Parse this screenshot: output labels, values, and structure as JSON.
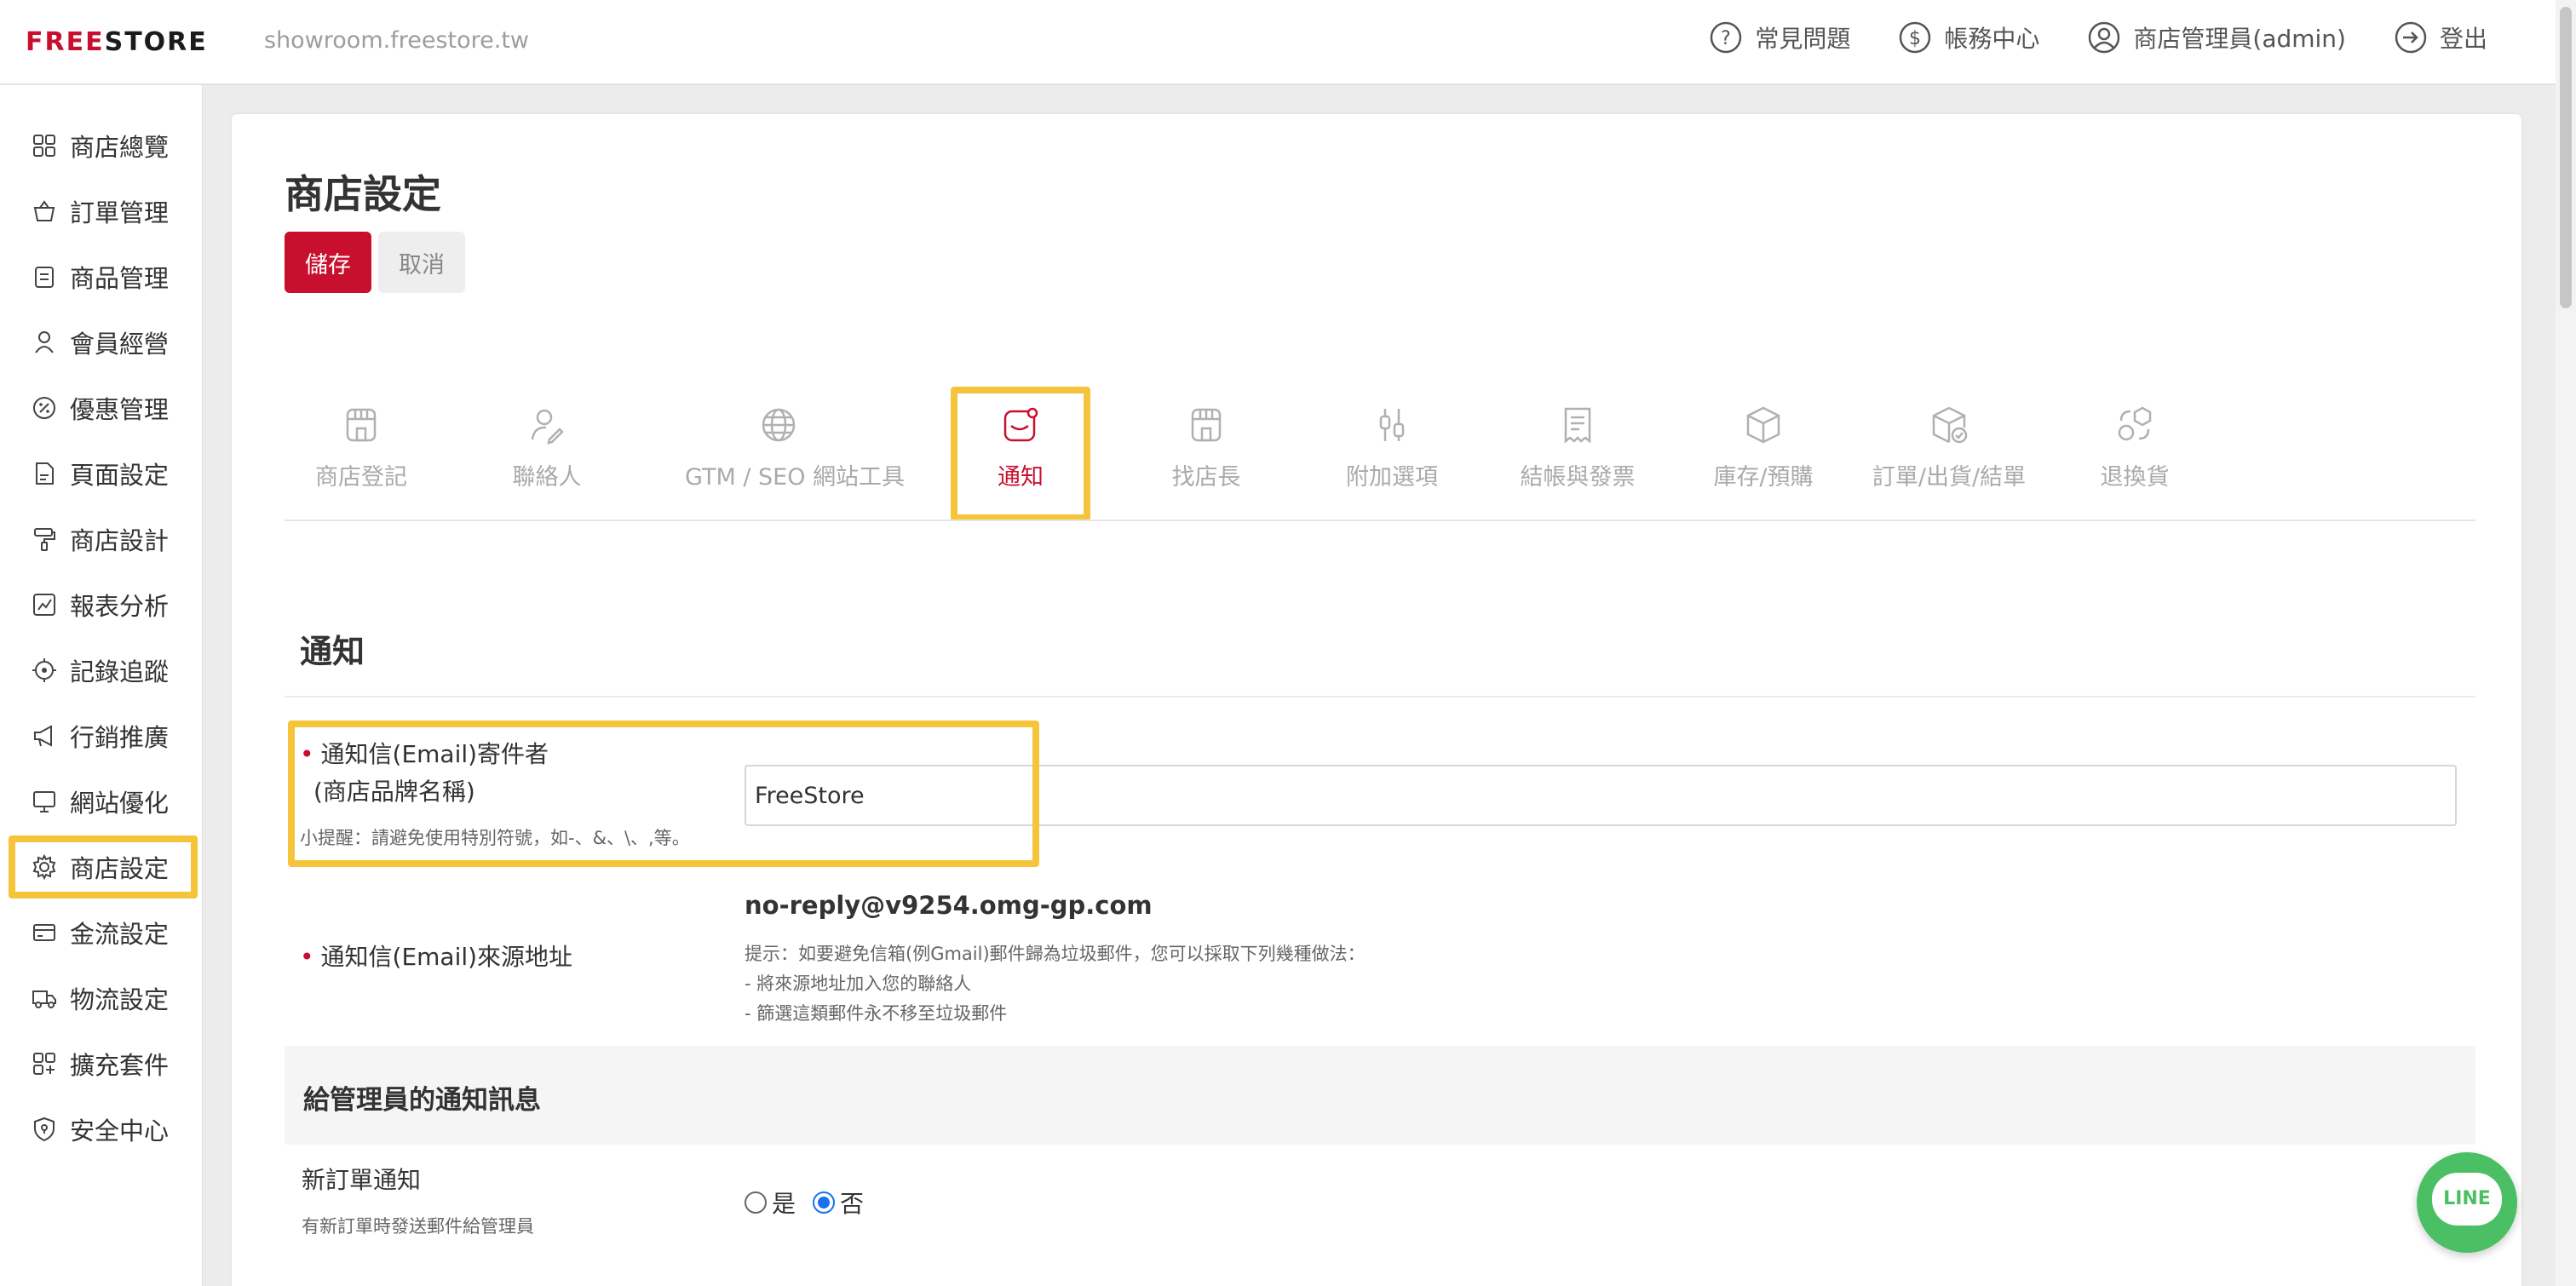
{
  "topbar": {
    "logo_prefix": "FREE",
    "logo_suffix": "STORE",
    "store_url": "showroom.freestore.tw",
    "links": [
      "常見問題",
      "帳務中心",
      "商店管理員(admin)",
      "登出"
    ]
  },
  "sidebar": {
    "items": [
      "商店總覽",
      "訂單管理",
      "商品管理",
      "會員經營",
      "優惠管理",
      "頁面設定",
      "商店設計",
      "報表分析",
      "記錄追蹤",
      "行銷推廣",
      "網站優化",
      "商店設定",
      "金流設定",
      "物流設定",
      "擴充套件",
      "安全中心"
    ],
    "active": "商店設定"
  },
  "page": {
    "title": "商店設定",
    "save_label": "儲存",
    "cancel_label": "取消"
  },
  "tabs": [
    "商店登記",
    "聯絡人",
    "GTM / SEO 網站工具",
    "通知",
    "找店長",
    "附加選項",
    "結帳與發票",
    "庫存/預購",
    "訂單/出貨/結單",
    "退換貨"
  ],
  "active_tab": "通知",
  "section": {
    "title": "通知",
    "sender_label_1": "通知信(Email)寄件者",
    "sender_label_2": "(商店品牌名稱)",
    "sender_hint": "小提醒：請避免使用特別符號，如-、&、\\、,等。",
    "sender_value": "FreeStore",
    "source_label": "通知信(Email)來源地址",
    "source_email": "no-reply@v9254.omg-gp.com",
    "tip_1": "提示：如要避免信箱(例Gmail)郵件歸為垃圾郵件，您可以採取下列幾種做法：",
    "tip_2": "- 將來源地址加入您的聯絡人",
    "tip_3": "- 篩選這類郵件永不移至垃圾郵件"
  },
  "admin_section": {
    "title": "給管理員的通知訊息",
    "new_order_label": "新訂單通知",
    "new_order_hint": "有新訂單時發送郵件給管理員",
    "yes_label": "是",
    "no_label": "否",
    "selected": "否"
  },
  "line_button": {
    "label": "LINE"
  },
  "colors": {
    "brand_red": "#c8102e",
    "highlight": "#f5c43a",
    "line_green": "#4bbf64"
  }
}
